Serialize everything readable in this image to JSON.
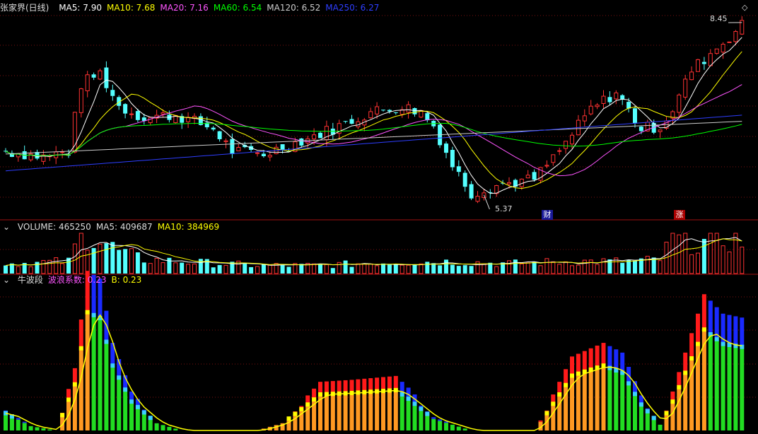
{
  "colors": {
    "up": "#ff3232",
    "down": "#54ffff",
    "ma5": "#ffffff",
    "ma10": "#ffff00",
    "ma20": "#ff55ff",
    "ma60": "#00ff00",
    "ma120": "#cccccc",
    "ma250": "#2e3eff",
    "grid": "#7a1010",
    "separator": "#a01010",
    "wave_red": "#ff1a1a",
    "wave_blue": "#1a2aff",
    "wave_green": "#22dd22",
    "wave_orange": "#ff9922",
    "wave_yellow": "#ffff00",
    "wave_cyan": "#3ccfff"
  },
  "price_panel": {
    "title": "张家界(日线)",
    "ma_legend": [
      {
        "label": "MA5: 7.90",
        "color": "#ffffff"
      },
      {
        "label": "MA10: 7.68",
        "color": "#ffff00"
      },
      {
        "label": "MA20: 7.16",
        "color": "#ff55ff"
      },
      {
        "label": "MA60: 6.54",
        "color": "#00ff00"
      },
      {
        "label": "MA120: 6.52",
        "color": "#cccccc"
      },
      {
        "label": "MA250: 6.27",
        "color": "#2e3eff"
      }
    ],
    "high_label": "8.45",
    "low_label": "5.37",
    "tag_cai": "财",
    "tag_zhang": "涨",
    "diamond_icon": "diamond-icon"
  },
  "volume_panel": {
    "legend": [
      {
        "label": "VOLUME: 465250",
        "color": "#dddddd"
      },
      {
        "label": "MA5: 409687",
        "color": "#dddddd"
      },
      {
        "label": "MA10: 384969",
        "color": "#ffff00"
      }
    ]
  },
  "indicator_panel": {
    "legend": [
      {
        "label": "牛波段",
        "color": "#dddddd"
      },
      {
        "label": "波浪系数: 0.23",
        "color": "#ff55ff"
      },
      {
        "label": "B: 0.23",
        "color": "#ffff00"
      }
    ]
  },
  "chart_data": {
    "type": "candlestick",
    "n_bars": 118,
    "price_ylim": [
      5.0,
      8.6
    ],
    "price_anchors": [
      [
        0,
        6.15
      ],
      [
        6,
        6.05
      ],
      [
        10,
        6.15
      ],
      [
        12,
        7.35
      ],
      [
        15,
        7.55
      ],
      [
        18,
        6.95
      ],
      [
        22,
        6.75
      ],
      [
        27,
        6.8
      ],
      [
        33,
        6.55
      ],
      [
        36,
        6.15
      ],
      [
        41,
        6.1
      ],
      [
        46,
        6.3
      ],
      [
        52,
        6.55
      ],
      [
        58,
        6.85
      ],
      [
        63,
        6.95
      ],
      [
        66,
        6.85
      ],
      [
        68,
        6.6
      ],
      [
        71,
        5.9
      ],
      [
        74,
        5.4
      ],
      [
        78,
        5.55
      ],
      [
        84,
        5.65
      ],
      [
        88,
        6.15
      ],
      [
        93,
        6.9
      ],
      [
        97,
        7.2
      ],
      [
        101,
        6.55
      ],
      [
        104,
        6.6
      ],
      [
        106,
        6.9
      ],
      [
        109,
        7.6
      ],
      [
        112,
        7.9
      ],
      [
        117,
        8.4
      ]
    ],
    "volume_anchors": [
      [
        0,
        0.25
      ],
      [
        10,
        0.3
      ],
      [
        12,
        1.0
      ],
      [
        15,
        0.85
      ],
      [
        18,
        0.55
      ],
      [
        22,
        0.35
      ],
      [
        30,
        0.28
      ],
      [
        40,
        0.2
      ],
      [
        50,
        0.2
      ],
      [
        60,
        0.28
      ],
      [
        70,
        0.3
      ],
      [
        80,
        0.25
      ],
      [
        90,
        0.3
      ],
      [
        100,
        0.3
      ],
      [
        104,
        0.35
      ],
      [
        106,
        0.85
      ],
      [
        110,
        0.75
      ],
      [
        114,
        0.85
      ],
      [
        117,
        0.8
      ]
    ],
    "wave_anchors": [
      [
        0,
        0.12
      ],
      [
        4,
        0.03
      ],
      [
        8,
        0.0
      ],
      [
        11,
        0.32
      ],
      [
        13,
        0.82
      ],
      [
        15,
        0.78
      ],
      [
        17,
        0.45
      ],
      [
        20,
        0.2
      ],
      [
        24,
        0.05
      ],
      [
        28,
        0.0
      ],
      [
        40,
        0.0
      ],
      [
        44,
        0.05
      ],
      [
        48,
        0.18
      ],
      [
        50,
        0.25
      ],
      [
        55,
        0.26
      ],
      [
        62,
        0.28
      ],
      [
        64,
        0.22
      ],
      [
        68,
        0.08
      ],
      [
        74,
        0.0
      ],
      [
        84,
        0.0
      ],
      [
        86,
        0.12
      ],
      [
        90,
        0.38
      ],
      [
        95,
        0.45
      ],
      [
        98,
        0.4
      ],
      [
        101,
        0.18
      ],
      [
        104,
        0.04
      ],
      [
        106,
        0.2
      ],
      [
        109,
        0.5
      ],
      [
        111,
        0.7
      ],
      [
        114,
        0.6
      ],
      [
        117,
        0.58
      ]
    ],
    "last_values": {
      "ma5": 7.9,
      "ma10": 7.68,
      "ma20": 7.16,
      "ma60": 6.54,
      "ma120": 6.52,
      "ma250": 6.27,
      "volume": 465250,
      "vol_ma5": 409687,
      "vol_ma10": 384969,
      "wave": 0.23,
      "b": 0.23
    },
    "high": 8.45,
    "low": 5.37
  }
}
